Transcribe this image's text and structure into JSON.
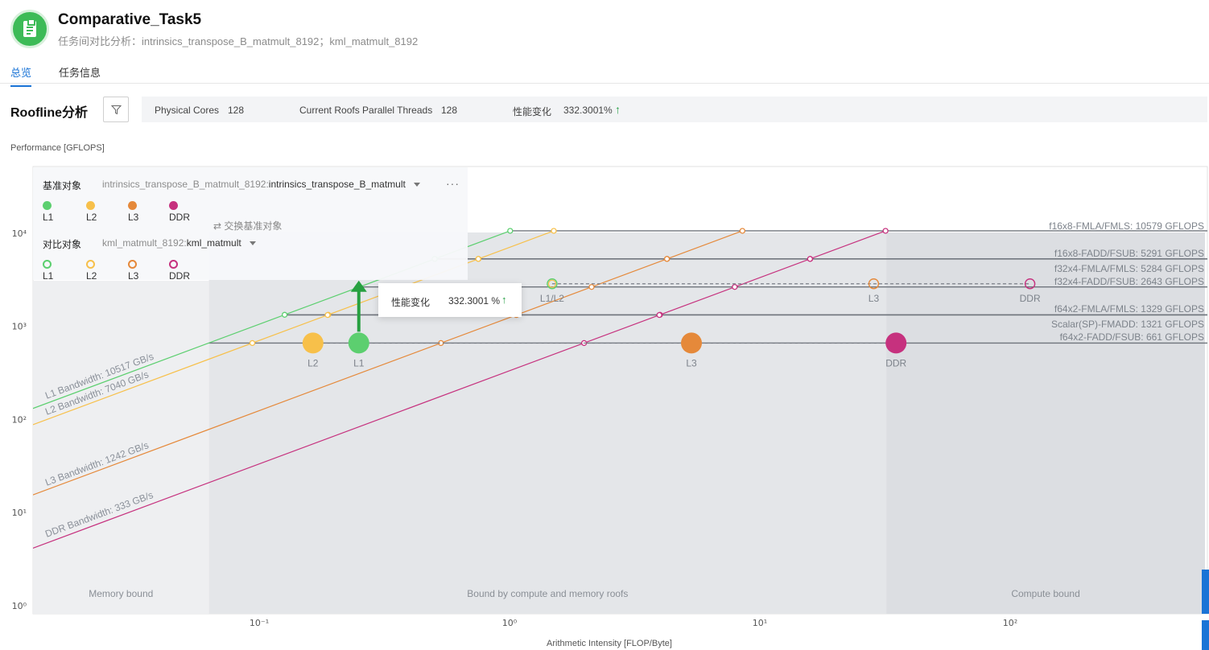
{
  "header": {
    "title": "Comparative_Task5",
    "subtitle": "任务间对比分析：intrinsics_transpose_B_matmult_8192；kml_matmult_8192"
  },
  "tabs": [
    {
      "label": "总览",
      "active": true
    },
    {
      "label": "任务信息",
      "active": false
    }
  ],
  "section": {
    "title": "Roofline分析"
  },
  "infobar": {
    "physical_cores_label": "Physical Cores",
    "physical_cores_value": "128",
    "threads_label": "Current Roofs Parallel Threads",
    "threads_value": "128",
    "perf_change_label": "性能变化",
    "perf_change_value": "332.3001%",
    "perf_change_arrow": "↑"
  },
  "legend": {
    "baseline_label": "基准对象",
    "baseline_value_prefix": "intrinsics_transpose_B_matmult_8192:",
    "baseline_value": "intrinsics_transpose_B_matmult",
    "compare_label": "对比对象",
    "compare_value_prefix": "kml_matmult_8192:",
    "compare_value": "kml_matmult",
    "swap_label": "交换基准对象",
    "more": "···",
    "items": [
      {
        "label": "L1",
        "color": "#5ccf6f"
      },
      {
        "label": "L2",
        "color": "#f7c04a"
      },
      {
        "label": "L3",
        "color": "#e5893a"
      },
      {
        "label": "DDR",
        "color": "#c6317e"
      }
    ]
  },
  "tooltip": {
    "label": "性能变化",
    "value": "332.3001 %",
    "arrow": "↑"
  },
  "chart_data": {
    "type": "scatter",
    "title": "",
    "ylabel": "Performance [GFLOPS]",
    "xlabel": "Arithmetic Intensity [FLOP/Byte]",
    "x_scale": "log",
    "y_scale": "log",
    "xlim": [
      0.0105,
      600
    ],
    "ylim": [
      0.9,
      20000
    ],
    "x_ticks": [
      {
        "value": 0.1,
        "label": "10⁻¹"
      },
      {
        "value": 1,
        "label": "10⁰"
      },
      {
        "value": 10,
        "label": "10¹"
      },
      {
        "value": 100,
        "label": "10²"
      }
    ],
    "y_ticks": [
      {
        "value": 1,
        "label": "10⁰"
      },
      {
        "value": 10,
        "label": "10¹"
      },
      {
        "value": 100,
        "label": "10²"
      },
      {
        "value": 1000,
        "label": "10³"
      },
      {
        "value": 10000,
        "label": "10⁴"
      }
    ],
    "regions": [
      {
        "label": "Memory bound",
        "x_from": 0.0105,
        "x_to": 0.063,
        "color": "#eeeff1"
      },
      {
        "label": "Bound by compute and memory roofs",
        "x_from": 0.063,
        "x_to": 32,
        "color": "#e4e6e9"
      },
      {
        "label": "Compute bound",
        "x_from": 32,
        "x_to": 600,
        "color": "#dcdee2"
      }
    ],
    "bandwidths": [
      {
        "name": "L1 Bandwidth: 10517 GB/s",
        "level": "L1",
        "value": 10517,
        "color": "#5ccf6f"
      },
      {
        "name": "L2 Bandwidth: 7040 GB/s",
        "level": "L2",
        "value": 7040,
        "color": "#f7c04a"
      },
      {
        "name": "L3 Bandwidth: 1242 GB/s",
        "level": "L3",
        "value": 1242,
        "color": "#e5893a"
      },
      {
        "name": "DDR Bandwidth: 333 GB/s",
        "level": "DDR",
        "value": 333,
        "color": "#c6317e"
      }
    ],
    "roofs": [
      {
        "name": "f16x8-FMLA/FMLS: 10579 GFLOPS",
        "value": 10579,
        "x_start": 1.006
      },
      {
        "name": "f16x8-FADD/FSUB: 5291 GFLOPS",
        "value": 5291,
        "x_start": 0.503
      },
      {
        "name": "f32x4-FMLA/FMLS: 5284 GFLOPS",
        "value": 5284,
        "x_start": 0.502
      },
      {
        "name": "f32x4-FADD/FSUB: 2643 GFLOPS",
        "value": 2643,
        "x_start": 0.251
      },
      {
        "name": "f64x2-FMLA/FMLS: 1329 GFLOPS",
        "value": 1329,
        "x_start": 0.126
      },
      {
        "name": "Scalar(SP)-FMADD: 1321 GFLOPS",
        "value": 1321,
        "x_start": 0.126
      },
      {
        "name": "f64x2-FADD/FSUB: 661 GFLOPS",
        "value": 661,
        "x_start": 0.063
      }
    ],
    "series": [
      {
        "name": "intrinsics_transpose_B_matmult",
        "style": "filled",
        "performance": 661,
        "points": [
          {
            "label": "L2",
            "x": 0.164
          },
          {
            "label": "L1",
            "x": 0.25
          },
          {
            "label": "L3",
            "x": 5.33
          },
          {
            "label": "DDR",
            "x": 35.0
          }
        ]
      },
      {
        "name": "kml_matmult",
        "style": "hollow",
        "performance": 2860,
        "points": [
          {
            "label": "L1/L2",
            "x": 1.48
          },
          {
            "label": "L3",
            "x": 28.5
          },
          {
            "label": "DDR",
            "x": 120
          }
        ]
      }
    ],
    "annotation": {
      "x": 0.25,
      "y_from": 661,
      "y_to": 2860,
      "label": "332.3001 %"
    }
  }
}
